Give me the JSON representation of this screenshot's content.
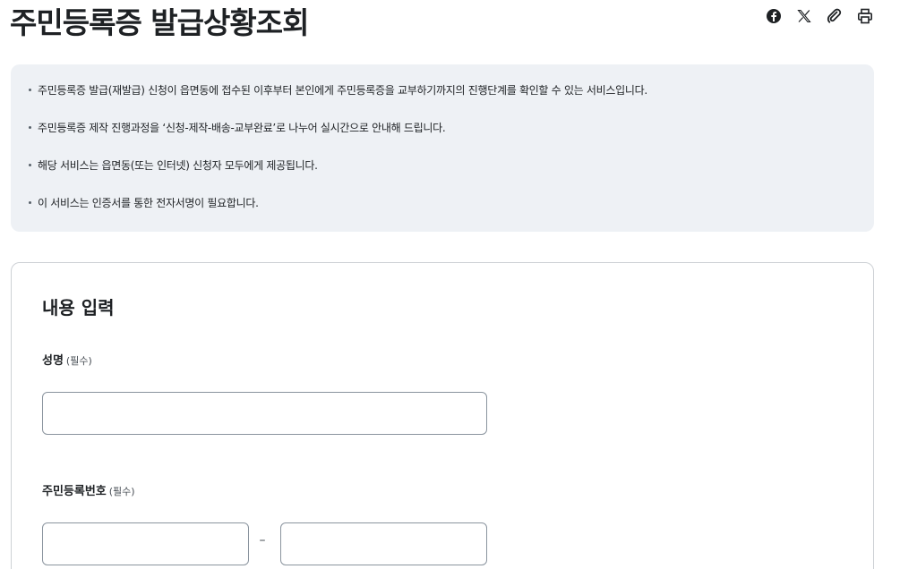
{
  "page": {
    "title": "주민등록증 발급상황조회"
  },
  "share_tools": [
    {
      "name": "facebook-icon"
    },
    {
      "name": "x-icon"
    },
    {
      "name": "link-icon"
    },
    {
      "name": "print-icon"
    }
  ],
  "info": {
    "items": [
      "주민등록증 발급(재발급) 신청이 읍면동에 접수된 이후부터 본인에게 주민등록증을 교부하기까지의 진행단계를 확인할 수 있는 서비스입니다.",
      "주민등록증 제작 진행과정을 ‘신청-제작-배송-교부완료’로 나누어 실시간으로 안내해 드립니다.",
      "해당 서비스는 읍면동(또는 인터넷) 신청자 모두에게 제공됩니다.",
      "이 서비스는 인증서를 통한 전자서명이 필요합니다."
    ]
  },
  "form": {
    "title": "내용 입력",
    "name_label": "성명",
    "name_required": "(필수)",
    "name_value": "",
    "rrn_label": "주민등록번호",
    "rrn_required": "(필수)",
    "rrn_separator": "–",
    "rrn_front_value": "",
    "rrn_back_value": ""
  },
  "colors": {
    "info_bg": "#eef1f5",
    "text": "#1e2124",
    "border": "#8a949e"
  }
}
